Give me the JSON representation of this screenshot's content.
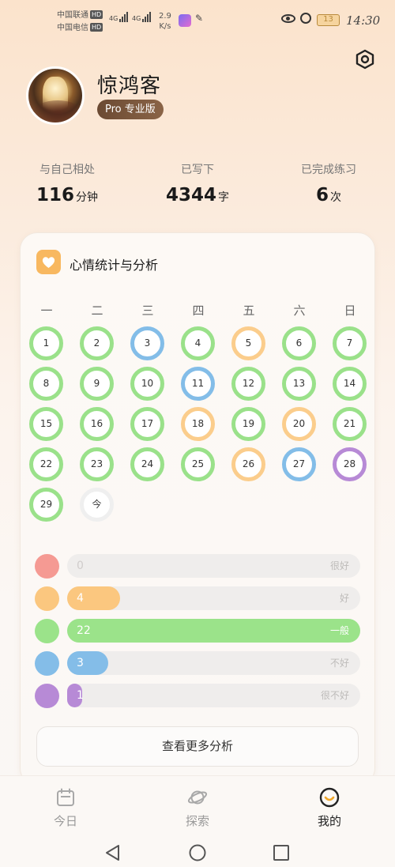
{
  "status_bar": {
    "carrier1": "中国联通",
    "carrier2": "中国电信",
    "hd": "HD",
    "net1": "4G",
    "net2": "4G",
    "speed_value": "2.9",
    "speed_unit": "K/s",
    "battery": "13",
    "time": "14:30"
  },
  "profile": {
    "name": "惊鸿客",
    "badge": "Pro 专业版"
  },
  "stats": [
    {
      "label": "与自己相处",
      "value": "116",
      "unit": "分钟"
    },
    {
      "label": "已写下",
      "value": "4344",
      "unit": "字"
    },
    {
      "label": "已完成练习",
      "value": "6",
      "unit": "次"
    }
  ],
  "mood_card": {
    "title": "心情统计与分析",
    "weekdays": [
      "一",
      "二",
      "三",
      "四",
      "五",
      "六",
      "日"
    ],
    "days": [
      {
        "label": "1",
        "mood": "g"
      },
      {
        "label": "2",
        "mood": "g"
      },
      {
        "label": "3",
        "mood": "b"
      },
      {
        "label": "4",
        "mood": "g"
      },
      {
        "label": "5",
        "mood": "o"
      },
      {
        "label": "6",
        "mood": "g"
      },
      {
        "label": "7",
        "mood": "g"
      },
      {
        "label": "8",
        "mood": "g"
      },
      {
        "label": "9",
        "mood": "g"
      },
      {
        "label": "10",
        "mood": "g"
      },
      {
        "label": "11",
        "mood": "b"
      },
      {
        "label": "12",
        "mood": "g"
      },
      {
        "label": "13",
        "mood": "g"
      },
      {
        "label": "14",
        "mood": "g"
      },
      {
        "label": "15",
        "mood": "g"
      },
      {
        "label": "16",
        "mood": "g"
      },
      {
        "label": "17",
        "mood": "g"
      },
      {
        "label": "18",
        "mood": "o"
      },
      {
        "label": "19",
        "mood": "g"
      },
      {
        "label": "20",
        "mood": "o"
      },
      {
        "label": "21",
        "mood": "g"
      },
      {
        "label": "22",
        "mood": "g"
      },
      {
        "label": "23",
        "mood": "g"
      },
      {
        "label": "24",
        "mood": "g"
      },
      {
        "label": "25",
        "mood": "g"
      },
      {
        "label": "26",
        "mood": "o"
      },
      {
        "label": "27",
        "mood": "b"
      },
      {
        "label": "28",
        "mood": "p"
      },
      {
        "label": "29",
        "mood": "g"
      },
      {
        "label": "今",
        "mood": "n"
      }
    ],
    "moods": [
      {
        "count": "0",
        "label": "很好",
        "color": "#f59a93",
        "fraction": 0
      },
      {
        "count": "4",
        "label": "好",
        "color": "#fbc77f",
        "fraction": 0.18
      },
      {
        "count": "22",
        "label": "一般",
        "color": "#9be38a",
        "fraction": 1.0
      },
      {
        "count": "3",
        "label": "不好",
        "color": "#84bde8",
        "fraction": 0.14
      },
      {
        "count": "1",
        "label": "很不好",
        "color": "#b78ad6",
        "fraction": 0.05
      }
    ],
    "more_button": "查看更多分析"
  },
  "tabs": [
    {
      "label": "今日",
      "icon": "calendar-icon"
    },
    {
      "label": "探索",
      "icon": "planet-icon"
    },
    {
      "label": "我的",
      "icon": "smile-face-icon"
    }
  ],
  "colors": {
    "accent_brown": "#6b4a33",
    "mood_green": "#9be38a",
    "mood_orange": "#fbc77f",
    "mood_blue": "#84bde8",
    "mood_purple": "#b78ad6",
    "mood_red": "#f59a93"
  }
}
